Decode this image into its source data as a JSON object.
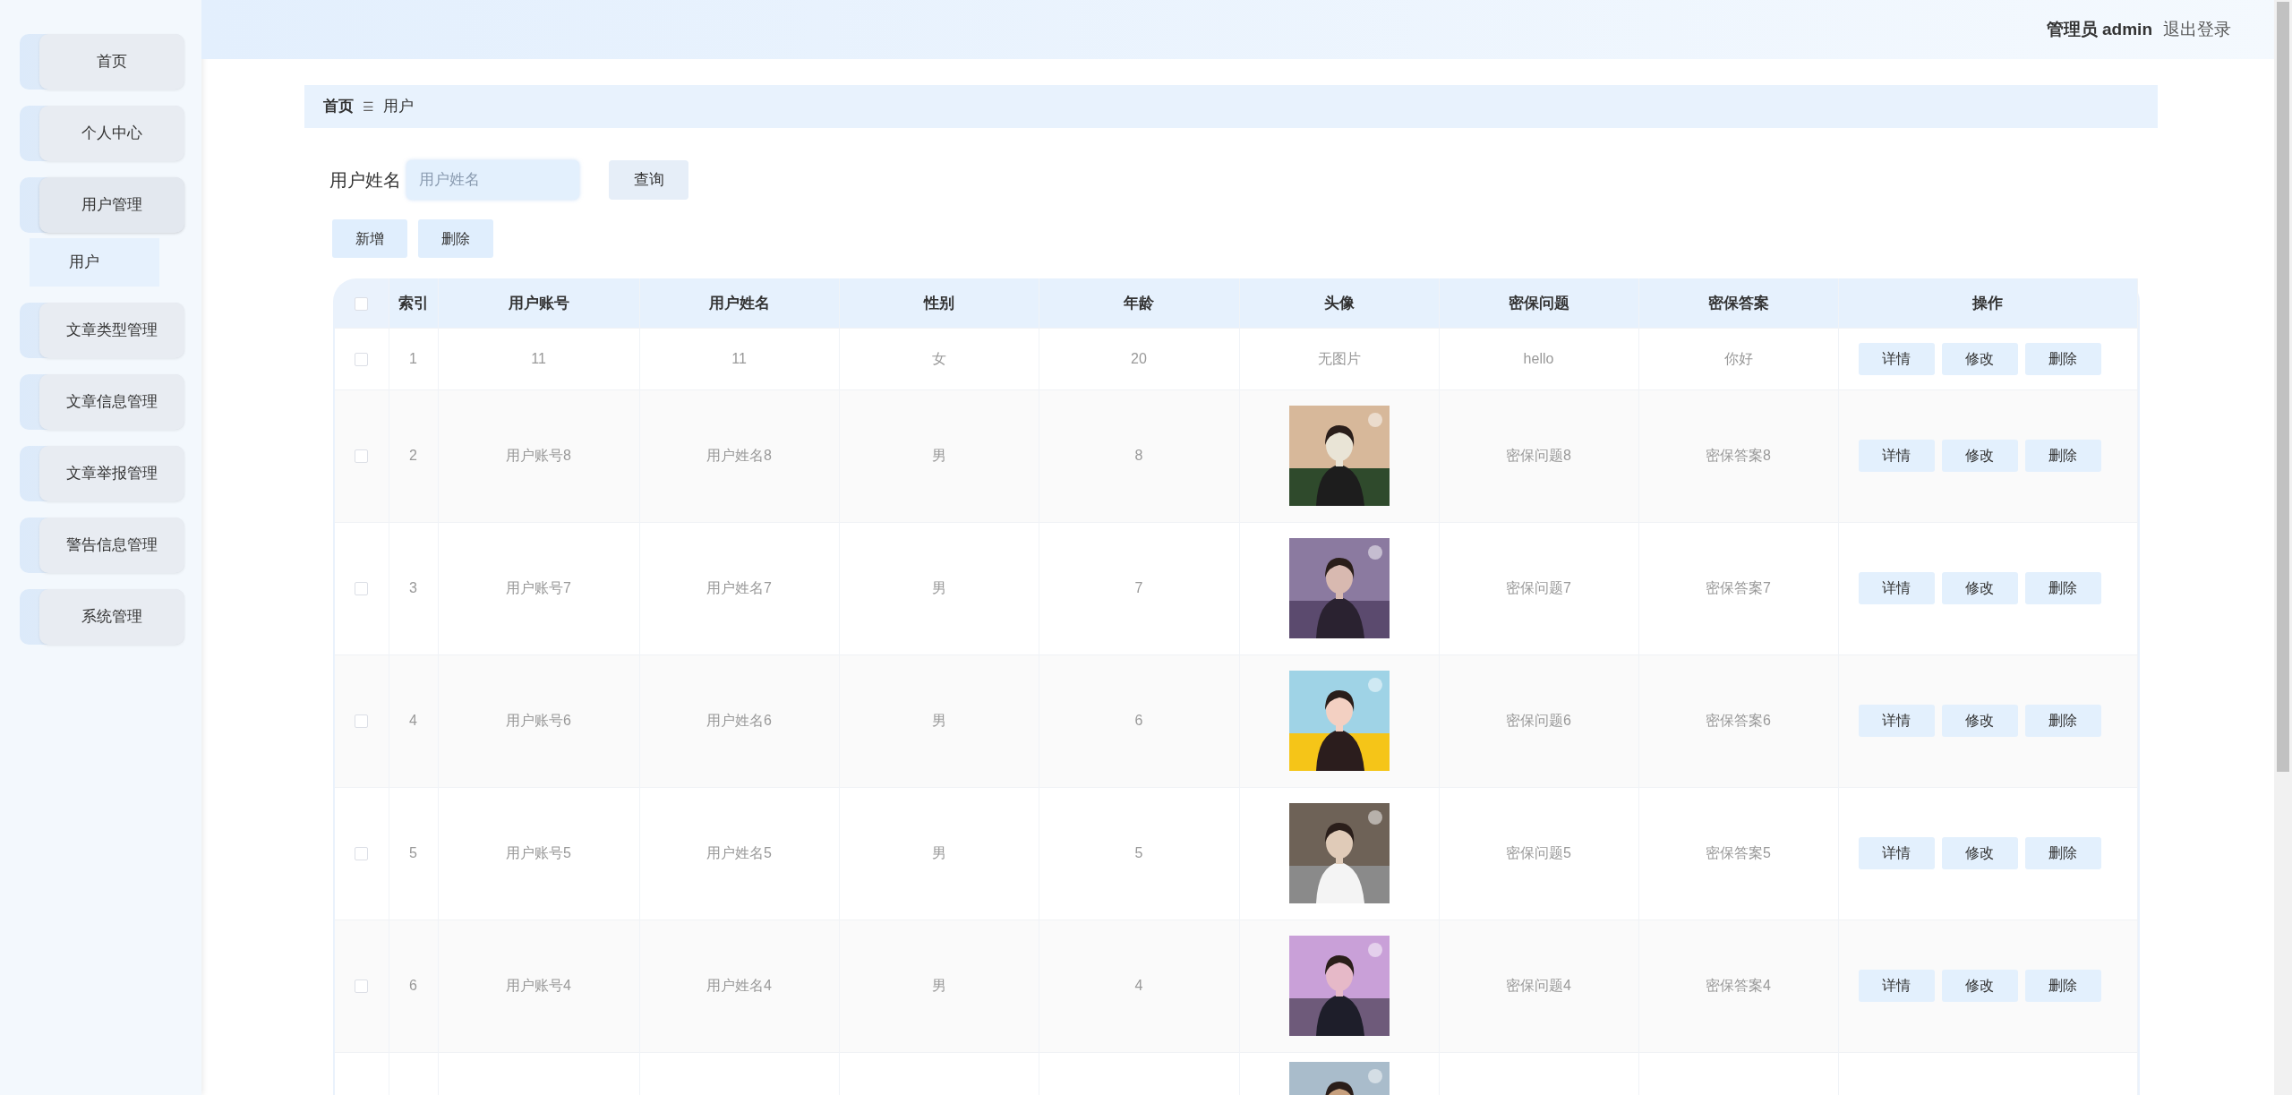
{
  "header": {
    "user_label": "管理员 admin",
    "logout": "退出登录"
  },
  "sidebar": {
    "items": [
      {
        "label": "首页",
        "expanded": false
      },
      {
        "label": "个人中心",
        "expanded": false
      },
      {
        "label": "用户管理",
        "expanded": true,
        "children": [
          {
            "label": "用户",
            "selected": true
          }
        ]
      },
      {
        "label": "文章类型管理",
        "expanded": false
      },
      {
        "label": "文章信息管理",
        "expanded": false
      },
      {
        "label": "文章举报管理",
        "expanded": false
      },
      {
        "label": "警告信息管理",
        "expanded": false
      },
      {
        "label": "系统管理",
        "expanded": false
      }
    ]
  },
  "breadcrumb": {
    "items": [
      "首页",
      "用户"
    ],
    "separator": "☰"
  },
  "search": {
    "label": "用户姓名",
    "placeholder": "用户姓名",
    "button": "查询"
  },
  "actions": [
    "新增",
    "删除"
  ],
  "table": {
    "all_checked": false,
    "columns": [
      "索引",
      "用户账号",
      "用户姓名",
      "性别",
      "年龄",
      "头像",
      "密保问题",
      "密保答案",
      "操作"
    ],
    "rows": [
      {
        "checked": false,
        "cells": [
          "1",
          "11",
          "11",
          "女",
          "20"
        ],
        "avatar": {
          "kind": "text",
          "text": "无图片"
        },
        "question": "hello",
        "answer": "你好",
        "buttons": [
          "详情",
          "修改",
          "删除"
        ]
      },
      {
        "checked": false,
        "cells": [
          "2",
          "用户账号8",
          "用户姓名8",
          "男",
          "8"
        ],
        "avatar": {
          "kind": "picture"
        },
        "question": "密保问题8",
        "answer": "密保答案8",
        "buttons": [
          "详情",
          "修改",
          "删除"
        ]
      },
      {
        "checked": false,
        "cells": [
          "3",
          "用户账号7",
          "用户姓名7",
          "男",
          "7"
        ],
        "avatar": {
          "kind": "picture"
        },
        "question": "密保问题7",
        "answer": "密保答案7",
        "buttons": [
          "详情",
          "修改",
          "删除"
        ]
      },
      {
        "checked": false,
        "cells": [
          "4",
          "用户账号6",
          "用户姓名6",
          "男",
          "6"
        ],
        "avatar": {
          "kind": "picture"
        },
        "question": "密保问题6",
        "answer": "密保答案6",
        "buttons": [
          "详情",
          "修改",
          "删除"
        ]
      },
      {
        "checked": false,
        "cells": [
          "5",
          "用户账号5",
          "用户姓名5",
          "男",
          "5"
        ],
        "avatar": {
          "kind": "picture"
        },
        "question": "密保问题5",
        "answer": "密保答案5",
        "buttons": [
          "详情",
          "修改",
          "删除"
        ]
      },
      {
        "checked": false,
        "cells": [
          "6",
          "用户账号4",
          "用户姓名4",
          "男",
          "4"
        ],
        "avatar": {
          "kind": "picture"
        },
        "question": "密保问题4",
        "answer": "密保答案4",
        "buttons": [
          "详情",
          "修改",
          "删除"
        ]
      },
      {
        "avatar": {
          "kind": "picture"
        }
      }
    ]
  }
}
